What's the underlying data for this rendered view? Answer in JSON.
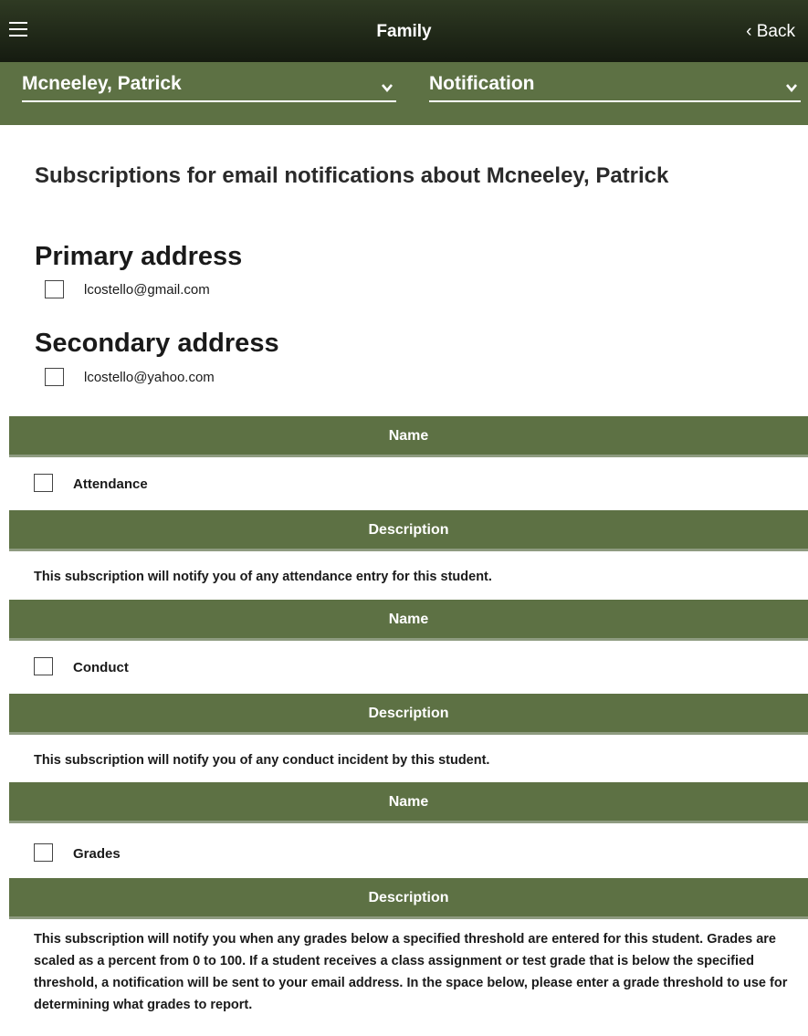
{
  "header": {
    "title": "Family",
    "back_label": "‹ Back"
  },
  "selectors": {
    "student": "Mcneeley, Patrick",
    "page": "Notification"
  },
  "main": {
    "heading": "Subscriptions for email notifications about Mcneeley, Patrick",
    "primary": {
      "title": "Primary address",
      "email": "lcostello@gmail.com"
    },
    "secondary": {
      "title": "Secondary address",
      "email": "lcostello@yahoo.com"
    },
    "subscriptions": [
      {
        "name_header": "Name",
        "name": "Attendance",
        "description_header": "Description",
        "description": "This subscription will notify you of any attendance entry for this student."
      },
      {
        "name_header": "Name",
        "name": "Conduct",
        "description_header": "Description",
        "description": "This subscription will notify you of any conduct incident by this student."
      },
      {
        "name_header": "Name",
        "name": "Grades",
        "description_header": "Description",
        "description": "This subscription will notify you when any grades below a specified threshold are entered for this student. Grades are scaled as a percent from 0 to 100. If a student receives a class assignment or test grade that is below the specified threshold, a notification will be sent to your email address. In the space below, please enter a grade threshold to use for determining what grades to report."
      }
    ]
  },
  "colors": {
    "header_dark": "#151b10",
    "band_green": "#5d7144"
  },
  "icons": {
    "menu": "hamburger-menu-icon",
    "dropdown": "chevron-down-icon"
  }
}
